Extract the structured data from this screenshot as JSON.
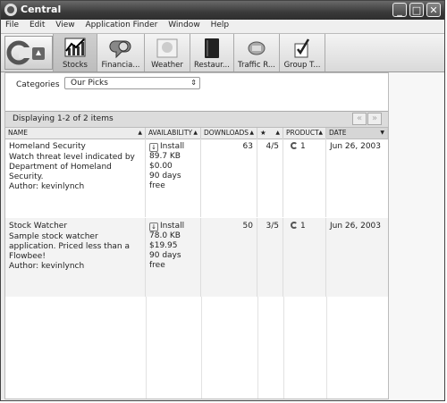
{
  "window": {
    "title": "Central",
    "minimize": "_",
    "maximize": "□",
    "close": "✕"
  },
  "menu": [
    "File",
    "Edit",
    "View",
    "Application Finder",
    "Window",
    "Help"
  ],
  "toolbar": {
    "logo_icon": "central-logo-icon",
    "tools": [
      {
        "label": "Stocks",
        "icon": "stocks-icon"
      },
      {
        "label": "Financia...",
        "icon": "finance-icon"
      },
      {
        "label": "Weather",
        "icon": "weather-icon"
      },
      {
        "label": "Restaur...",
        "icon": "restaurant-icon"
      },
      {
        "label": "Traffic R...",
        "icon": "traffic-icon"
      },
      {
        "label": "Group T...",
        "icon": "group-icon"
      }
    ]
  },
  "filter": {
    "label": "Categories",
    "selected": "Our Picks"
  },
  "listing": {
    "status": "Displaying 1-2 of 2 items",
    "prev": "«",
    "next": "»",
    "columns": [
      "NAME",
      "AVAILABILITY",
      "DOWNLOADS",
      "★",
      "PRODUCT",
      "DATE"
    ],
    "rows": [
      {
        "name": "Homeland Security",
        "desc": "Watch threat level indicated by Department of Homeland Security.",
        "author": "Author:  kevinlynch",
        "action": "Install",
        "size": "89.7 KB",
        "price": "$0.00",
        "trial": "90 days free",
        "downloads": "63",
        "rating": "4/5",
        "product": "1",
        "date": "Jun 26, 2003"
      },
      {
        "name": "Stock Watcher",
        "desc": "Sample stock watcher application. Priced less than a Flowbee!",
        "author": "Author:  kevinlynch",
        "action": "Install",
        "size": "78.0 KB",
        "price": "$19.95",
        "trial": "90 days free",
        "downloads": "50",
        "rating": "3/5",
        "product": "1",
        "date": "Jun 26, 2003"
      }
    ]
  }
}
